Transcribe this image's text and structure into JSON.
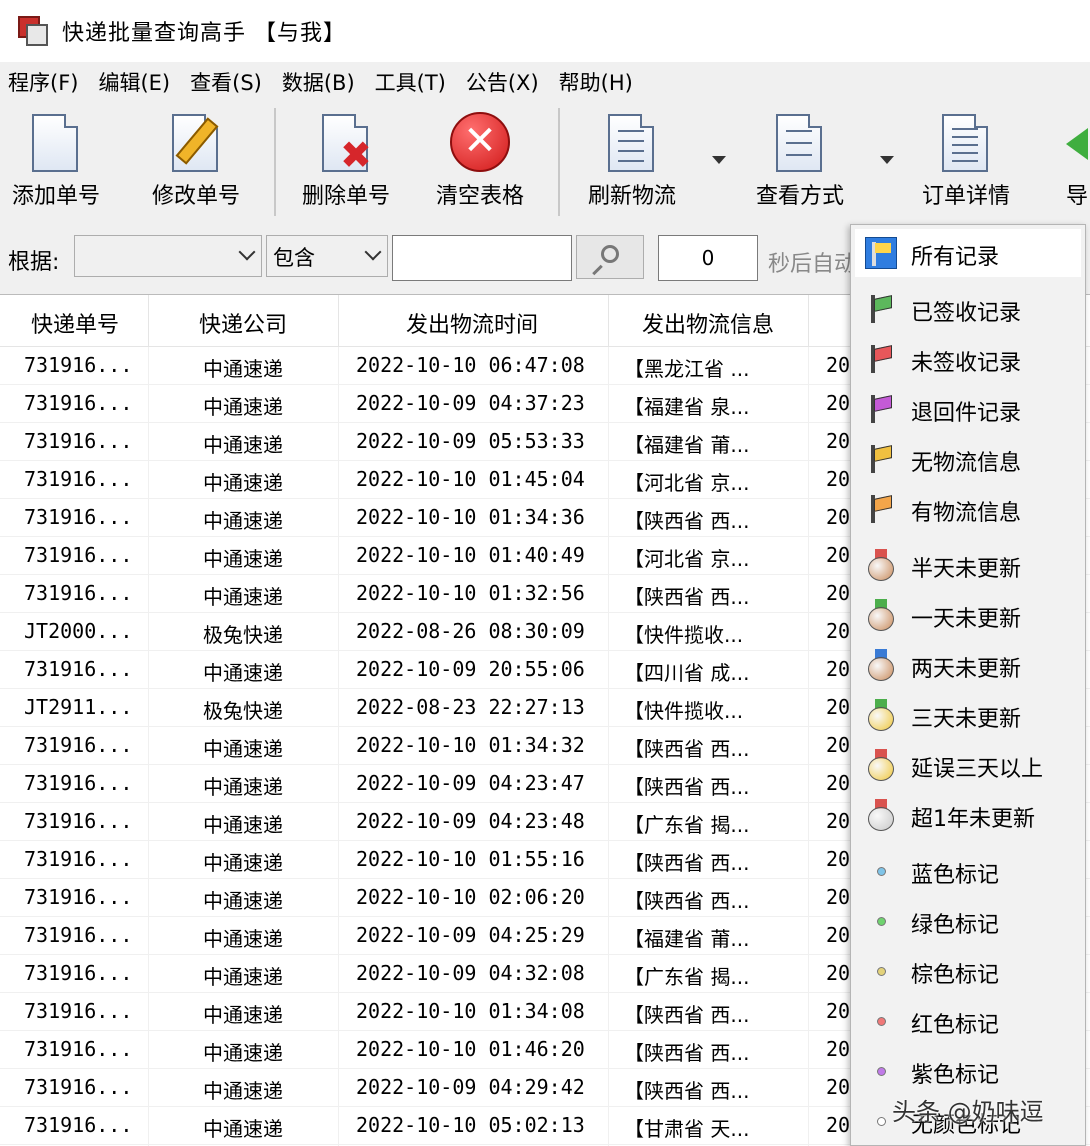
{
  "window": {
    "title": "快递批量查询高手 【与我】"
  },
  "menu": [
    "程序(F)",
    "编辑(E)",
    "查看(S)",
    "数据(B)",
    "工具(T)",
    "公告(X)",
    "帮助(H)"
  ],
  "toolbar": {
    "add": "添加单号",
    "edit": "修改单号",
    "delete": "删除单号",
    "clear": "清空表格",
    "refresh": "刷新物流",
    "view": "查看方式",
    "detail": "订单详情",
    "export": "导出"
  },
  "filter": {
    "label": "根据:",
    "field_value": "",
    "match_value": "包含",
    "search_value": "",
    "interval_value": "0",
    "tail_text": "秒后自动"
  },
  "table": {
    "columns": [
      "快递单号",
      "快递公司",
      "发出物流时间",
      "发出物流信息"
    ],
    "rows": [
      [
        "731916...",
        "中通速递",
        "2022-10-10 06:47:08",
        "【黑龙江省 ...",
        "20"
      ],
      [
        "731916...",
        "中通速递",
        "2022-10-09 04:37:23",
        "【福建省 泉...",
        "20"
      ],
      [
        "731916...",
        "中通速递",
        "2022-10-09 05:53:33",
        "【福建省 莆...",
        "20"
      ],
      [
        "731916...",
        "中通速递",
        "2022-10-10 01:45:04",
        "【河北省 京...",
        "20"
      ],
      [
        "731916...",
        "中通速递",
        "2022-10-10 01:34:36",
        "【陕西省 西...",
        "20"
      ],
      [
        "731916...",
        "中通速递",
        "2022-10-10 01:40:49",
        "【河北省 京...",
        "20"
      ],
      [
        "731916...",
        "中通速递",
        "2022-10-10 01:32:56",
        "【陕西省 西...",
        "20"
      ],
      [
        "JT2000...",
        "极兔快递",
        "2022-08-26 08:30:09",
        "【快件揽收...",
        "20"
      ],
      [
        "731916...",
        "中通速递",
        "2022-10-09 20:55:06",
        "【四川省 成...",
        "20"
      ],
      [
        "JT2911...",
        "极兔快递",
        "2022-08-23 22:27:13",
        "【快件揽收...",
        "20"
      ],
      [
        "731916...",
        "中通速递",
        "2022-10-10 01:34:32",
        "【陕西省 西...",
        "20"
      ],
      [
        "731916...",
        "中通速递",
        "2022-10-09 04:23:47",
        "【陕西省 西...",
        "20"
      ],
      [
        "731916...",
        "中通速递",
        "2022-10-09 04:23:48",
        "【广东省 揭...",
        "20"
      ],
      [
        "731916...",
        "中通速递",
        "2022-10-10 01:55:16",
        "【陕西省 西...",
        "20"
      ],
      [
        "731916...",
        "中通速递",
        "2022-10-10 02:06:20",
        "【陕西省 西...",
        "20"
      ],
      [
        "731916...",
        "中通速递",
        "2022-10-09 04:25:29",
        "【福建省 莆...",
        "20"
      ],
      [
        "731916...",
        "中通速递",
        "2022-10-09 04:32:08",
        "【广东省 揭...",
        "20"
      ],
      [
        "731916...",
        "中通速递",
        "2022-10-10 01:34:08",
        "【陕西省 西...",
        "20"
      ],
      [
        "731916...",
        "中通速递",
        "2022-10-10 01:46:20",
        "【陕西省 西...",
        "20"
      ],
      [
        "731916...",
        "中通速递",
        "2022-10-09 04:29:42",
        "【陕西省 西...",
        "20"
      ],
      [
        "731916...",
        "中通速递",
        "2022-10-10 05:02:13",
        "【甘肃省 天...",
        "20"
      ]
    ]
  },
  "dropdown": {
    "items": [
      {
        "label": "所有记录",
        "icon": "all-records-flag-icon",
        "kind": "box",
        "selected": true
      },
      {
        "label": "已签收记录",
        "icon": "green-flag-icon",
        "kind": "flag",
        "color": "#5cb85c"
      },
      {
        "label": "未签收记录",
        "icon": "red-flag-icon",
        "kind": "flag",
        "color": "#e8575a"
      },
      {
        "label": "退回件记录",
        "icon": "purple-flag-icon",
        "kind": "flag",
        "color": "#c45ad6"
      },
      {
        "label": "无物流信息",
        "icon": "yellow-flag-icon",
        "kind": "flag",
        "color": "#f0c040"
      },
      {
        "label": "有物流信息",
        "icon": "orange-flag-icon",
        "kind": "flag",
        "color": "#f3a54a"
      },
      {
        "label": "半天未更新",
        "icon": "bronze-medal-icon",
        "kind": "medal",
        "ribbon": "#d9534f",
        "color": "#c98a5a"
      },
      {
        "label": "一天未更新",
        "icon": "bronze-medal-icon",
        "kind": "medal",
        "ribbon": "#4cae4c",
        "color": "#c98a5a"
      },
      {
        "label": "两天未更新",
        "icon": "bronze-medal-icon",
        "kind": "medal",
        "ribbon": "#3a7bd5",
        "color": "#c98a5a"
      },
      {
        "label": "三天未更新",
        "icon": "gold-medal-icon",
        "kind": "medal",
        "ribbon": "#4cae4c",
        "color": "#f0c73a"
      },
      {
        "label": "延误三天以上",
        "icon": "gold-medal-icon",
        "kind": "medal",
        "ribbon": "#d9534f",
        "color": "#f0c73a"
      },
      {
        "label": "超1年未更新",
        "icon": "silver-medal-icon",
        "kind": "medal",
        "ribbon": "#d9534f",
        "color": "#c8c8c8"
      },
      {
        "label": "蓝色标记",
        "icon": "blue-dot-icon",
        "kind": "dot",
        "color": "#7fc4e8"
      },
      {
        "label": "绿色标记",
        "icon": "green-dot-icon",
        "kind": "dot",
        "color": "#6fd36f"
      },
      {
        "label": "棕色标记",
        "icon": "brown-dot-icon",
        "kind": "dot",
        "color": "#e3d27a"
      },
      {
        "label": "红色标记",
        "icon": "red-dot-icon",
        "kind": "dot",
        "color": "#f07878"
      },
      {
        "label": "紫色标记",
        "icon": "purple-dot-icon",
        "kind": "dot",
        "color": "#c07ae8"
      },
      {
        "label": "无颜色标记",
        "icon": "empty-dot-icon",
        "kind": "dot",
        "color": "#ffffff"
      }
    ]
  },
  "watermark": "头条 @奶味逗"
}
